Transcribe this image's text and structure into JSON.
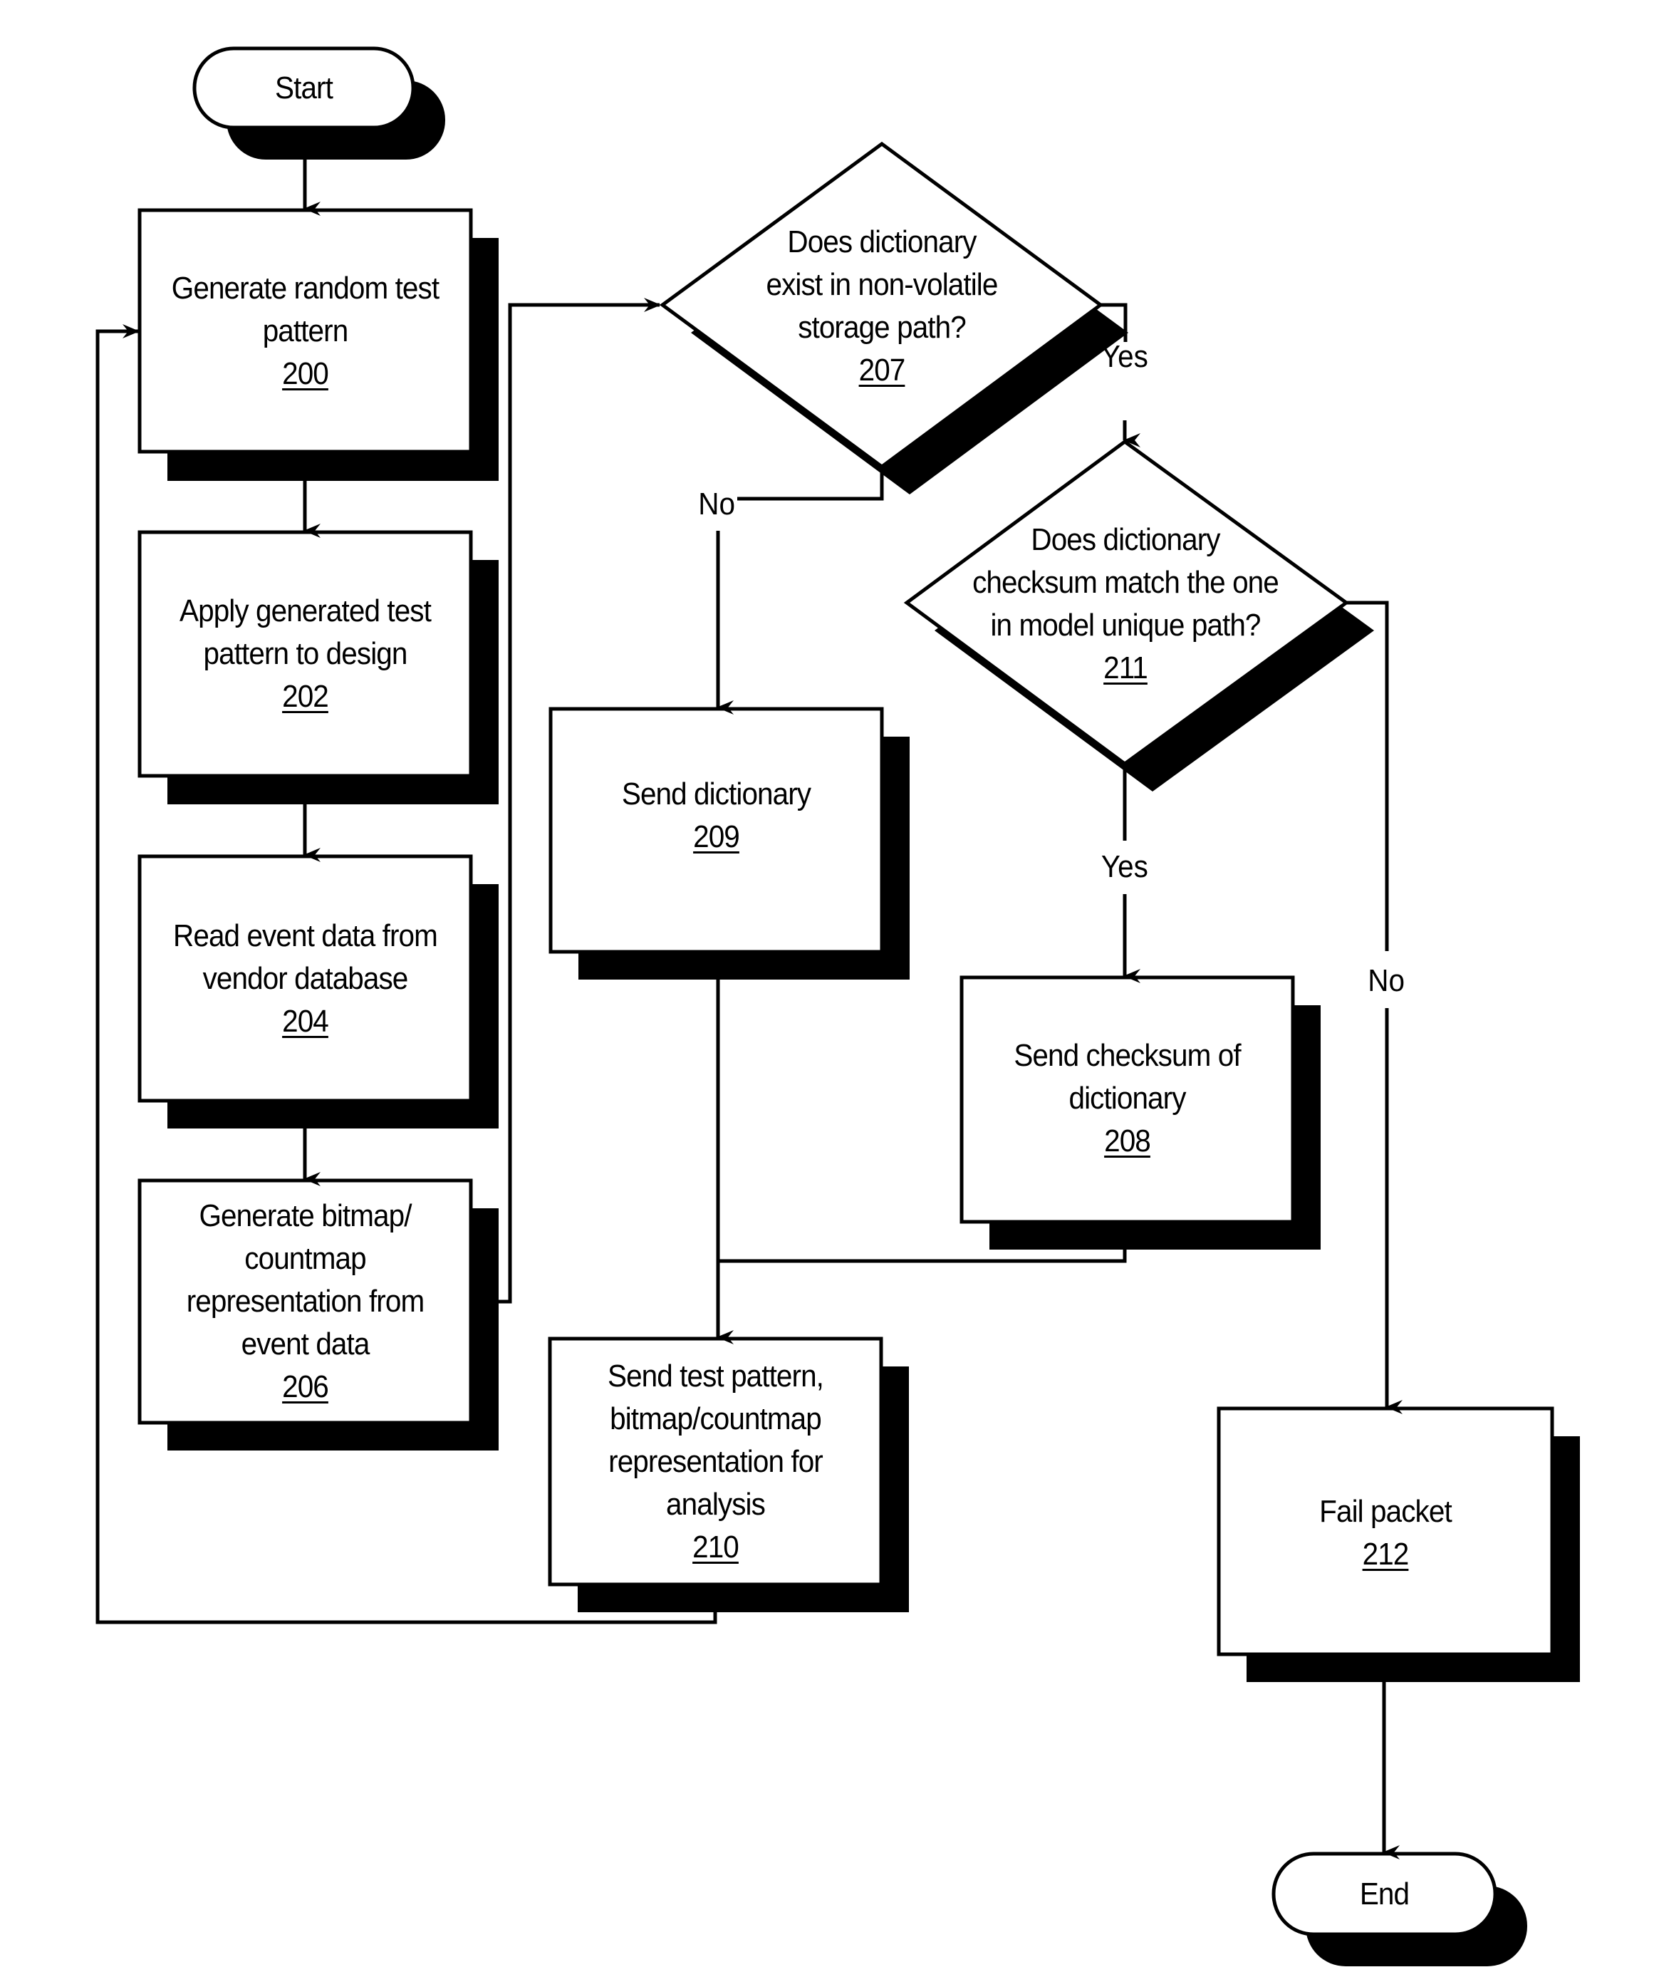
{
  "diagram": {
    "type": "flowchart",
    "colors": {
      "stroke": "#000000",
      "fill": "#ffffff",
      "shadow": "#000000"
    },
    "nodes": {
      "start": {
        "kind": "terminator",
        "label": "Start"
      },
      "n200": {
        "kind": "process",
        "label_lines": [
          "Generate random test",
          "pattern"
        ],
        "ref": "200"
      },
      "n202": {
        "kind": "process",
        "label_lines": [
          "Apply generated test",
          "pattern to design"
        ],
        "ref": "202"
      },
      "n204": {
        "kind": "process",
        "label_lines": [
          "Read event data from",
          "vendor database"
        ],
        "ref": "204"
      },
      "n206": {
        "kind": "process",
        "label_lines": [
          "Generate bitmap/",
          "countmap",
          "representation from",
          "event data"
        ],
        "ref": "206"
      },
      "n207": {
        "kind": "decision",
        "label_lines": [
          "Does dictionary",
          "exist in non-volatile",
          "storage path?"
        ],
        "ref": "207"
      },
      "n209": {
        "kind": "process",
        "label_lines": [
          "Send dictionary"
        ],
        "ref": "209"
      },
      "n211": {
        "kind": "decision",
        "label_lines": [
          "Does dictionary",
          "checksum match the one",
          "in model unique path?"
        ],
        "ref": "211"
      },
      "n208": {
        "kind": "process",
        "label_lines": [
          "Send checksum of",
          "dictionary"
        ],
        "ref": "208"
      },
      "n210": {
        "kind": "process",
        "label_lines": [
          "Send test pattern,",
          "bitmap/countmap",
          "representation for",
          "analysis"
        ],
        "ref": "210"
      },
      "n212": {
        "kind": "process",
        "label_lines": [
          "Fail packet"
        ],
        "ref": "212"
      },
      "end": {
        "kind": "terminator",
        "label": "End"
      }
    },
    "edges": [
      {
        "from": "start",
        "to": "n200",
        "label": ""
      },
      {
        "from": "n200",
        "to": "n202",
        "label": ""
      },
      {
        "from": "n202",
        "to": "n204",
        "label": ""
      },
      {
        "from": "n204",
        "to": "n206",
        "label": ""
      },
      {
        "from": "n206",
        "to": "n207",
        "label": ""
      },
      {
        "from": "n207",
        "to": "n211",
        "label": "Yes"
      },
      {
        "from": "n207",
        "to": "n209",
        "label": "No"
      },
      {
        "from": "n211",
        "to": "n208",
        "label": "Yes"
      },
      {
        "from": "n211",
        "to": "n212",
        "label": "No"
      },
      {
        "from": "n209",
        "to": "n210",
        "label": ""
      },
      {
        "from": "n208",
        "to": "n210",
        "label": ""
      },
      {
        "from": "n210",
        "to": "n200",
        "label": ""
      },
      {
        "from": "n212",
        "to": "end",
        "label": ""
      }
    ],
    "edge_labels": {
      "yes_207": "Yes",
      "no_207": "No",
      "yes_211": "Yes",
      "no_211": "No"
    }
  }
}
